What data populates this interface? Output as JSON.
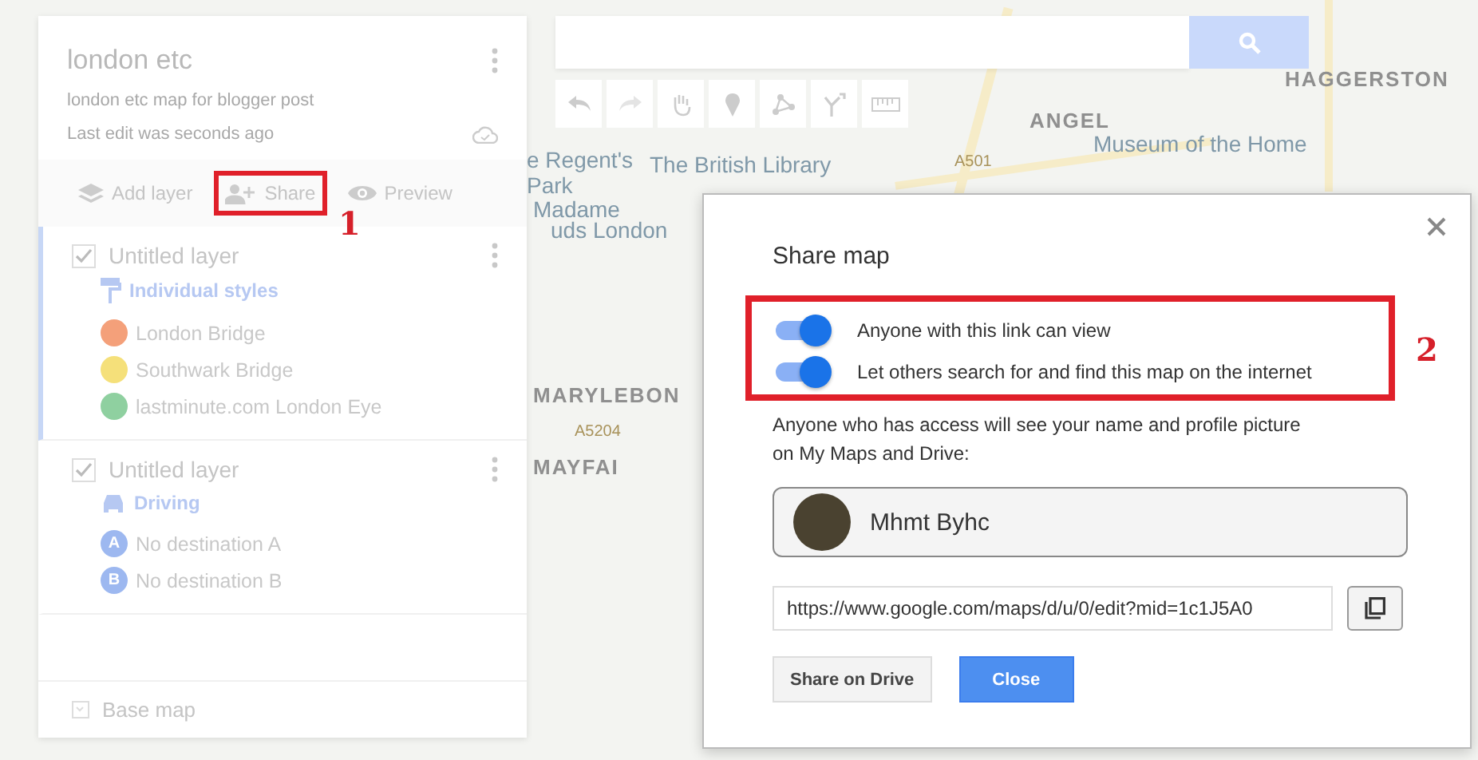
{
  "map_labels": [
    {
      "text": "HAGGERSTON",
      "kind": "district"
    },
    {
      "text": "ANGEL",
      "kind": "district"
    },
    {
      "text": "Museum of the Home",
      "kind": "place"
    },
    {
      "text": "e Regent's",
      "kind": "place"
    },
    {
      "text": "The British Library",
      "kind": "place"
    },
    {
      "text": "A501",
      "kind": "road"
    },
    {
      "text": "Park",
      "kind": "place"
    },
    {
      "text": "Madame",
      "kind": "place"
    },
    {
      "text": "uds London",
      "kind": "place"
    },
    {
      "text": "MARYLEBON",
      "kind": "district"
    },
    {
      "text": "A5204",
      "kind": "road"
    },
    {
      "text": "MAYFAI",
      "kind": "district"
    }
  ],
  "panel": {
    "title": "london etc",
    "description": "london etc map for blogger post",
    "status": "Last edit was seconds ago",
    "actions": [
      {
        "label": "Add layer",
        "kind": "layer",
        "highlighted": false
      },
      {
        "label": "Share",
        "kind": "share",
        "highlighted": true
      },
      {
        "label": "Preview",
        "kind": "preview",
        "highlighted": false
      }
    ],
    "layers": [
      {
        "name": "Untitled layer",
        "checked": true,
        "selected": true,
        "style": "Individual styles",
        "kind": "paint",
        "items": [
          {
            "label": "London Bridge",
            "color": "#f4a07a",
            "marker": ""
          },
          {
            "label": "Southwark Bridge",
            "color": "#f5e07a",
            "marker": ""
          },
          {
            "label": "lastminute.com London Eye",
            "color": "#8fd0a0",
            "marker": ""
          }
        ]
      },
      {
        "name": "Untitled layer",
        "checked": true,
        "selected": false,
        "style": "Driving",
        "kind": "car",
        "items": [
          {
            "label": "No destination A",
            "color": "#9db8f0",
            "marker": "A"
          },
          {
            "label": "No destination B",
            "color": "#9db8f0",
            "marker": "B"
          }
        ]
      }
    ],
    "base_map": "Base map"
  },
  "dialog": {
    "title": "Share map",
    "toggles": [
      {
        "label": "Anyone with this link can view",
        "on": true
      },
      {
        "label": "Let others search for and find this map on the internet",
        "on": true
      }
    ],
    "notice": "Anyone who has access will see your name and profile picture on My Maps and Drive:",
    "user_name": "Mhmt Byhc",
    "link": "https://www.google.com/maps/d/u/0/edit?mid=1c1J5A0",
    "buttons": [
      {
        "label": "Share on Drive",
        "kind": "secondary"
      },
      {
        "label": "Close",
        "kind": "primary"
      }
    ]
  },
  "annotations": [
    {
      "number": "1"
    },
    {
      "number": "2"
    }
  ]
}
